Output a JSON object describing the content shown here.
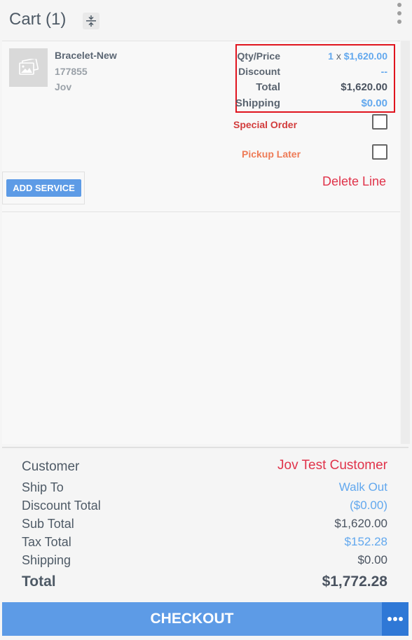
{
  "header": {
    "title": "Cart (1)"
  },
  "item": {
    "name": "Bracelet-New",
    "sku": "177855",
    "vendor": "Jov",
    "qty_price_label": "Qty/Price",
    "qty": "1",
    "qty_x": "x",
    "unit_price": "$1,620.00",
    "discount_label": "Discount",
    "discount_value": "--",
    "total_label": "Total",
    "total_value": "$1,620.00",
    "shipping_label": "Shipping",
    "shipping_value": "$0.00",
    "special_order_label": "Special Order",
    "pickup_later_label": "Pickup Later",
    "add_service_label": "ADD SERVICE",
    "delete_line_label": "Delete Line"
  },
  "summary": {
    "customer_label": "Customer",
    "customer_value": "Jov Test Customer",
    "ship_to_label": "Ship To",
    "ship_to_value": "Walk Out",
    "discount_total_label": "Discount Total",
    "discount_total_value": "($0.00)",
    "sub_total_label": "Sub Total",
    "sub_total_value": "$1,620.00",
    "tax_total_label": "Tax Total",
    "tax_total_value": "$152.28",
    "shipping_label": "Shipping",
    "shipping_value": "$0.00",
    "total_label": "Total",
    "total_value": "$1,772.28"
  },
  "checkout": {
    "label": "CHECKOUT"
  },
  "colors": {
    "accent_blue": "#5d9be6",
    "link_blue": "#62a8ee",
    "customer_red": "#e0334a",
    "special_order_red": "#d23c3c",
    "pickup_orange": "#ee7b57",
    "highlight_border": "#e0141e"
  },
  "icons": {
    "collapse": "collapse-vertical-icon",
    "menu": "more-vertical-icon",
    "thumbnail": "image-placeholder-icon",
    "checkout_more": "more-horizontal-icon"
  }
}
